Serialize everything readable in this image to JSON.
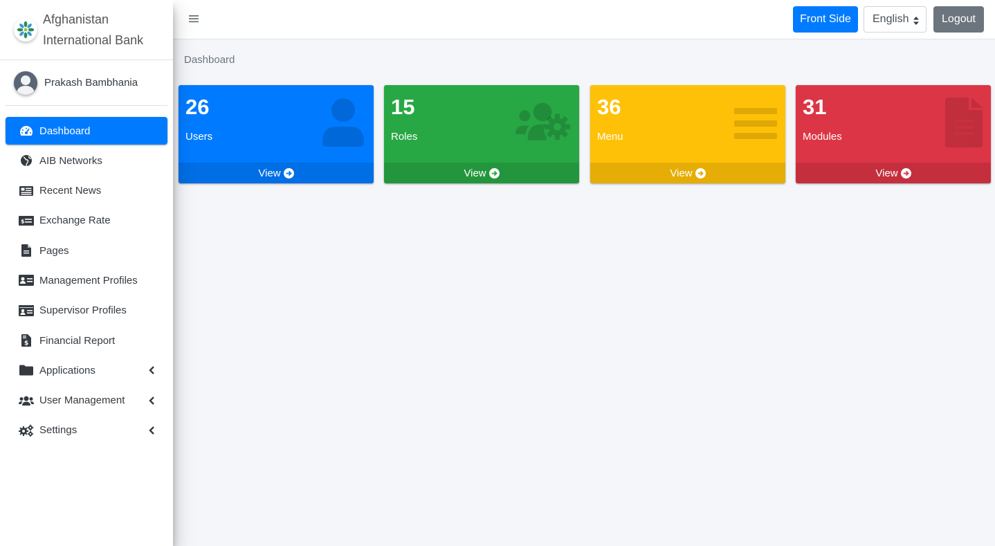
{
  "brand": {
    "line1": "Afghanistan",
    "line2": "International Bank"
  },
  "user": {
    "name": "Prakash Bambhania"
  },
  "sidebar": {
    "items": [
      {
        "label": "Dashboard",
        "icon": "tachometer-icon",
        "active": true
      },
      {
        "label": "AIB Networks",
        "icon": "globe-icon"
      },
      {
        "label": "Recent News",
        "icon": "newspaper-icon"
      },
      {
        "label": "Exchange Rate",
        "icon": "money-bill-icon"
      },
      {
        "label": "Pages",
        "icon": "file-icon"
      },
      {
        "label": "Management Profiles",
        "icon": "id-card-icon"
      },
      {
        "label": "Supervisor Profiles",
        "icon": "id-card-icon"
      },
      {
        "label": "Financial Report",
        "icon": "file-invoice-dollar-icon"
      },
      {
        "label": "Applications",
        "icon": "folder-icon",
        "has_children": true
      },
      {
        "label": "User Management",
        "icon": "users-icon",
        "has_children": true
      },
      {
        "label": "Settings",
        "icon": "cogs-icon",
        "has_children": true
      }
    ]
  },
  "header": {
    "front_side_label": "Front Side",
    "language_value": "English",
    "logout_label": "Logout"
  },
  "breadcrumb": "Dashboard",
  "boxes": [
    {
      "count": "26",
      "label": "Users",
      "footer": "View",
      "color": "#007bff",
      "icon": "user-icon"
    },
    {
      "count": "15",
      "label": "Roles",
      "footer": "View",
      "color": "#28a745",
      "icon": "users-cog-icon"
    },
    {
      "count": "36",
      "label": "Menu",
      "footer": "View",
      "color": "#ffc107",
      "icon": "bars-icon"
    },
    {
      "count": "31",
      "label": "Modules",
      "footer": "View",
      "color": "#dc3545",
      "icon": "file-alt-icon"
    }
  ]
}
